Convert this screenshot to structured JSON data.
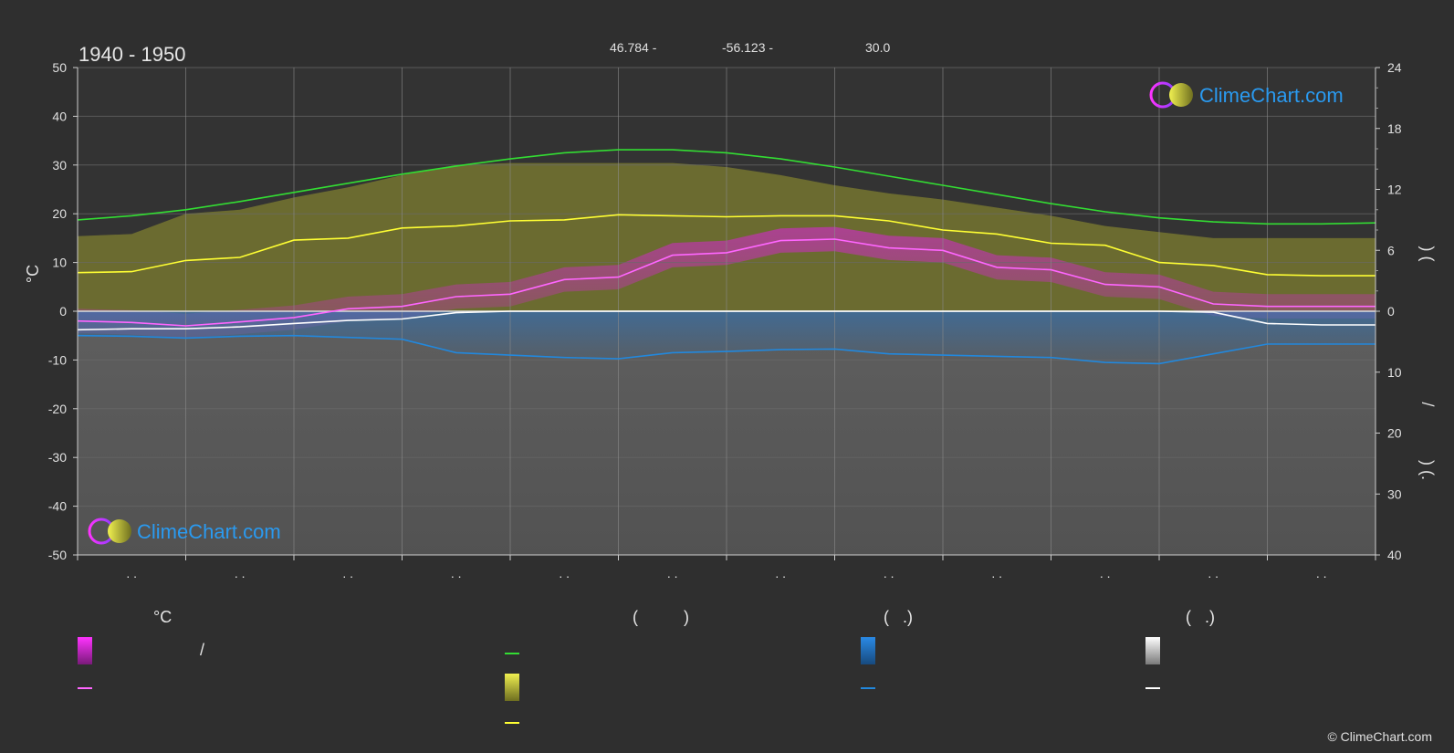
{
  "period": "1940 - 1950",
  "coords": {
    "lat": "46.784 -",
    "lon": "-56.123 -",
    "elevation": "30.0"
  },
  "logo_text": "ClimeChart.com",
  "copyright": "© ClimeChart.com",
  "colors": {
    "background": "#2f2f2f",
    "sunshine_line": "#33dd33",
    "sunshine_area": "#c8c832",
    "temp_line": "#ff66ff",
    "temp_area": "#e020e0",
    "precip_line": "#2288dd",
    "precip_area": "#1e78d2",
    "snow_line": "#ffffff",
    "snow_area": "#c8c8c8",
    "sunny_line": "#ffff33"
  },
  "legend": {
    "col1_header": "°C",
    "col1_item1_sep": "/",
    "col2_header": "(          )",
    "col3_header": "(   .)",
    "col4_header": "(   .)"
  },
  "chart_data": {
    "type": "area",
    "x_tick_labels": [
      ". .",
      ". .",
      ". .",
      ". .",
      ". .",
      ". .",
      ". .",
      ". .",
      ". .",
      ". .",
      ". .",
      ". ."
    ],
    "left_axis": {
      "unit": "°C",
      "range": [
        -50,
        50
      ],
      "ticks": [
        50,
        40,
        30,
        20,
        10,
        0,
        -10,
        -20,
        -30,
        -40,
        -50
      ]
    },
    "right_axis_top": {
      "range": [
        0,
        24
      ],
      "ticks": [
        24,
        18,
        12,
        6,
        0
      ]
    },
    "right_axis_bottom": {
      "range": [
        0,
        40
      ],
      "ticks": [
        10,
        20,
        30,
        40
      ]
    },
    "right_axis_label_top": ")      (",
    "right_axis_label_mid": "/",
    "right_axis_label_bottom": ")   (.",
    "x": [
      0,
      0.5,
      1,
      1.5,
      2,
      2.5,
      3,
      3.5,
      4,
      4.5,
      5,
      5.5,
      6,
      6.5,
      7,
      7.5,
      8,
      8.5,
      9,
      9.5,
      10,
      10.5,
      11,
      11.5,
      12
    ],
    "series": [
      {
        "key": "daylight_hours",
        "values": [
          9.0,
          9.4,
          10.0,
          10.8,
          11.7,
          12.6,
          13.5,
          14.3,
          15.0,
          15.6,
          15.9,
          15.9,
          15.6,
          15.0,
          14.2,
          13.3,
          12.4,
          11.5,
          10.6,
          9.8,
          9.2,
          8.8,
          8.6,
          8.6,
          8.7
        ]
      },
      {
        "key": "sunshine_hours",
        "values": [
          3.8,
          3.9,
          5.0,
          5.3,
          7.0,
          7.2,
          8.2,
          8.4,
          8.9,
          9.0,
          9.5,
          9.4,
          9.3,
          9.4,
          9.4,
          8.9,
          8.0,
          7.6,
          6.7,
          6.5,
          4.8,
          4.5,
          3.6,
          3.5,
          3.5
        ]
      },
      {
        "key": "sunshine_max_hours",
        "values": [
          7.4,
          7.6,
          9.6,
          10.0,
          11.2,
          12.2,
          13.4,
          14.4,
          14.6,
          14.6,
          14.6,
          14.6,
          14.2,
          13.4,
          12.4,
          11.6,
          11.0,
          10.2,
          9.4,
          8.4,
          7.8,
          7.2,
          7.2,
          7.2,
          7.2
        ]
      },
      {
        "key": "mean_temperature",
        "values": [
          -2.0,
          -2.3,
          -3.0,
          -2.2,
          -1.3,
          0.5,
          1.0,
          3.0,
          3.5,
          6.5,
          7.0,
          11.5,
          12.0,
          14.5,
          14.8,
          13.0,
          12.5,
          9.0,
          8.5,
          5.5,
          5.0,
          1.5,
          1.0,
          1.0,
          1.0
        ]
      },
      {
        "key": "snow_line_temp",
        "values": [
          -3.8,
          -3.6,
          -3.6,
          -3.2,
          -2.5,
          -1.9,
          -1.6,
          -0.3,
          0.0,
          0.0,
          0.0,
          0.0,
          0.0,
          0.0,
          0.0,
          0.0,
          0.0,
          0.0,
          0.0,
          0.0,
          0.0,
          -0.2,
          -2.5,
          -2.8,
          -2.8
        ]
      },
      {
        "key": "precipitation_mm",
        "values": [
          4.0,
          4.1,
          4.4,
          4.1,
          4.0,
          4.3,
          4.6,
          6.8,
          7.2,
          7.6,
          7.8,
          6.8,
          6.6,
          6.3,
          6.2,
          7.0,
          7.2,
          7.4,
          7.6,
          8.4,
          8.6,
          7.0,
          5.4,
          5.4,
          5.4
        ]
      }
    ]
  }
}
